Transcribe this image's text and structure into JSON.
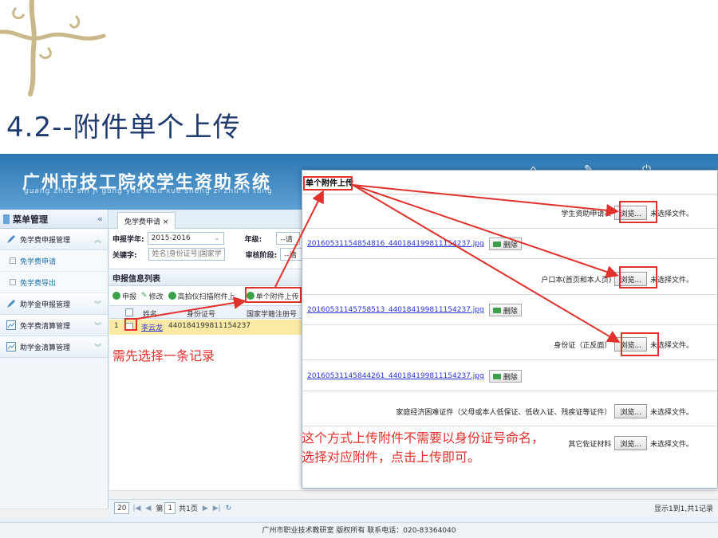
{
  "slide": {
    "title": "4.2--附件单个上传"
  },
  "app": {
    "title": "广州市技工院校学生资助系统",
    "subtitle": "guang zhou shi ji gong yue xiao xue sheng zi zhu xi tong",
    "footer": "广州市职业技术教研室   版权所有   联系电话：020-83364040"
  },
  "menu": {
    "header": "菜单管理",
    "collapse": "«",
    "items": [
      {
        "label": "免学费申报管理",
        "type": "group",
        "chev": "︽"
      },
      {
        "label": "免学费申请",
        "type": "sub"
      },
      {
        "label": "免学费导出",
        "type": "sub"
      },
      {
        "label": "助学金申报管理",
        "type": "group",
        "chev": "︾"
      },
      {
        "label": "免学费清算管理",
        "type": "group",
        "chev": "︾"
      },
      {
        "label": "助学金清算管理",
        "type": "group",
        "chev": "︾"
      }
    ]
  },
  "tab": {
    "label": "免学费申请 ×"
  },
  "form": {
    "year_label": "申报学年:",
    "year_value": "2015-2016",
    "grade_label": "年级:",
    "grade_value": "--请",
    "keyword_label": "关键字:",
    "keyword_placeholder": "姓名|身份证号|国家学籍注",
    "stage_label": "审核阶段:",
    "stage_value": "--请"
  },
  "list": {
    "title": "申报信息列表",
    "toolbar": [
      "申报",
      "修改",
      "高拍仪扫描附件上",
      "单个附件上传"
    ],
    "columns": [
      "姓名",
      "身份证号",
      "国家学籍注册号"
    ],
    "rows": [
      {
        "index": "1",
        "name": "李云龙",
        "id_number": "440184199811154237",
        "reg_no": ""
      }
    ]
  },
  "notes": {
    "select_first": "需先选择一条记录",
    "explain_line1": "这个方式上传附件不需要以身份证号命名，",
    "explain_line2": "选择对应附件，点击上传即可。"
  },
  "pager": {
    "page_size": "20",
    "page_label": "第",
    "page_value": "1",
    "total_pages": "共1页",
    "info": "显示1到1,共1记录"
  },
  "dialog": {
    "title": "单个附件上传",
    "browse_label": "浏览...",
    "no_file": "未选择文件。",
    "delete_label": "删除",
    "uploads": [
      {
        "label": "学生资助申请表"
      },
      {
        "label": "户口本(首页和本人页)"
      },
      {
        "label": "身份证（正反面）"
      },
      {
        "label": "家庭经济困难证件（父母或本人低保证、低收入证、残疾证等证件）"
      },
      {
        "label": "其它佐证材料"
      }
    ],
    "files": [
      "20160531154854816_440184199811154237.jpg",
      "20160531145758513_440184199811154237.jpg",
      "20160531145844261_440184199811154237.jpg"
    ]
  },
  "colors": {
    "accent_red": "#e0312d",
    "header_blue": "#2c78b5",
    "title_navy": "#1f3a6e"
  }
}
